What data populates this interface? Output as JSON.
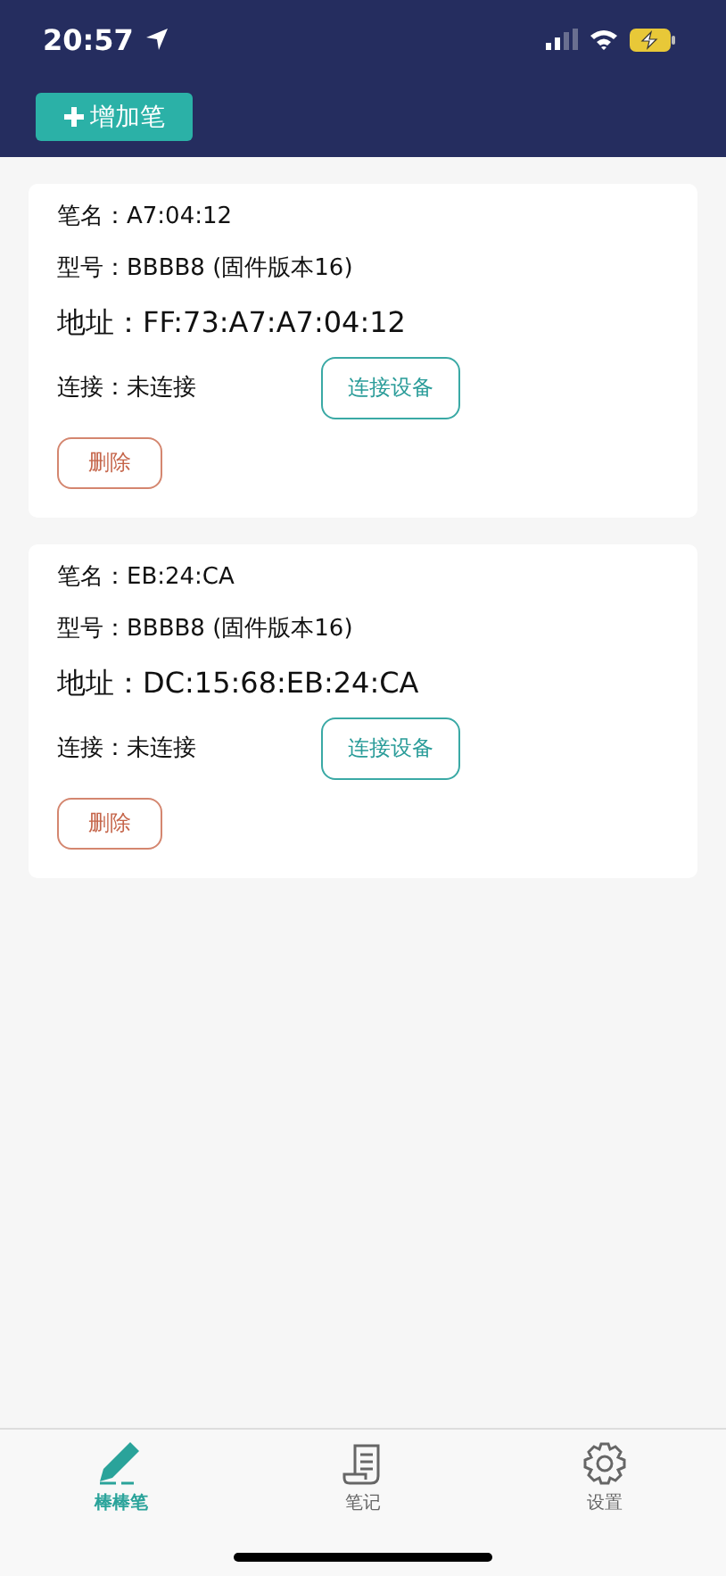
{
  "status_bar": {
    "time": "20:57"
  },
  "add_button": {
    "label": "增加笔"
  },
  "pens": [
    {
      "name": "笔名：A7:04:12",
      "model": "型号：BBBB8 (固件版本16)",
      "address": "地址：FF:73:A7:A7:04:12",
      "connection": "连接：未连接",
      "connect_button": "连接设备",
      "delete_button": "删除"
    },
    {
      "name": "笔名：EB:24:CA",
      "model": "型号：BBBB8 (固件版本16)",
      "address": "地址：DC:15:68:EB:24:CA",
      "connection": "连接：未连接",
      "connect_button": "连接设备",
      "delete_button": "删除"
    }
  ],
  "tabs": [
    {
      "label": "棒棒笔",
      "kind": "pencil",
      "selected": true
    },
    {
      "label": "笔记",
      "kind": "scroll",
      "selected": false
    },
    {
      "label": "设置",
      "kind": "gear",
      "selected": false
    }
  ]
}
